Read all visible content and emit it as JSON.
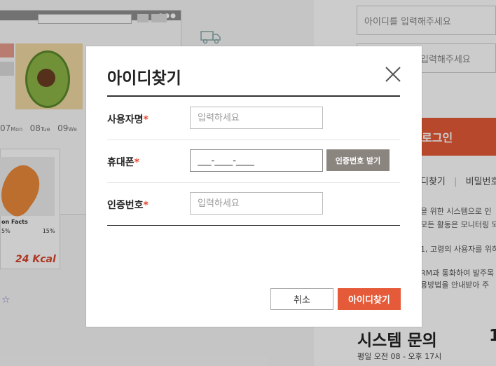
{
  "background": {
    "dates": [
      "07",
      "Mon",
      "08",
      "Tue",
      "09",
      "We"
    ],
    "nutrition_label": "on Facts",
    "nutrition_pcts": [
      "5%",
      "15%"
    ],
    "kcal": "24 Kcal",
    "id_placeholder": "아이디를 입력해주세요",
    "pw_placeholder": "입력해주세요",
    "login_label": "로그인",
    "find_id_link": "디찾기",
    "find_pw_link": "비밀번호",
    "notice_lines": [
      "을 위한 시스템으로 인",
      "모든 활동은 모니터링 되",
      "1, 고령의 사용자를 위하",
      "RM과 통화하여 발주목",
      "용방법을 안내받아 주"
    ],
    "system_title": "시스템 문의",
    "system_hours": "평일 오전 08 - 오후 17시",
    "system_number": "1"
  },
  "modal": {
    "title": "아이디찾기",
    "fields": [
      {
        "label": "사용자명",
        "required": "*",
        "placeholder": "입력하세요",
        "value": ""
      },
      {
        "label": "휴대폰",
        "required": "*",
        "placeholder": "",
        "value": "___-____-____"
      },
      {
        "label": "인증번호",
        "required": "*",
        "placeholder": "입력하세요",
        "value": ""
      }
    ],
    "auth_button": "인증번호 받기",
    "cancel_button": "취소",
    "submit_button": "아이디찾기"
  },
  "colors": {
    "accent": "#e55a38",
    "required": "#e8462c",
    "auth_button": "#8b8580"
  }
}
